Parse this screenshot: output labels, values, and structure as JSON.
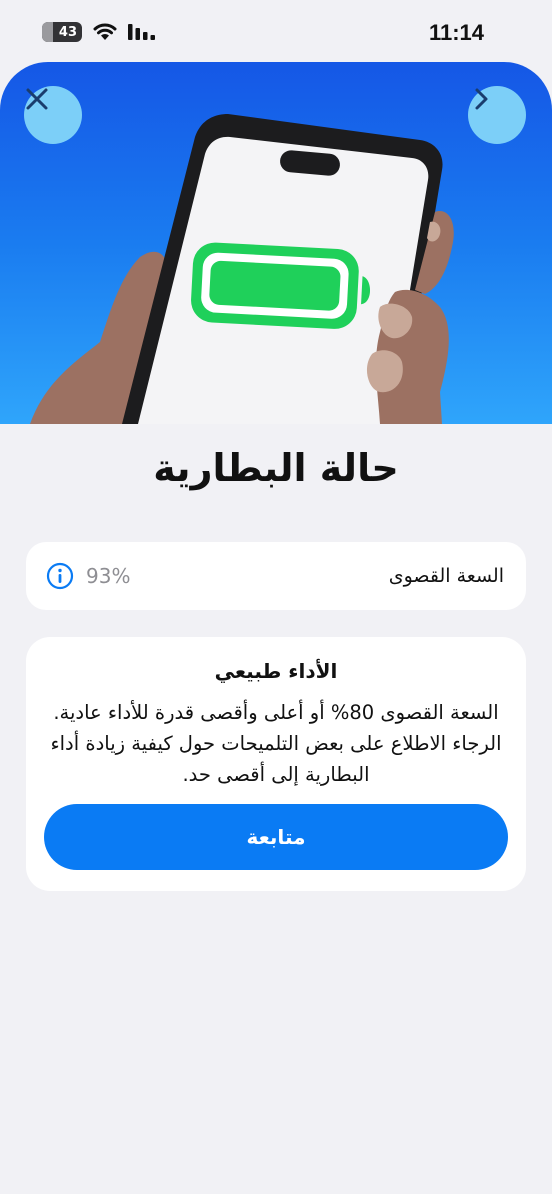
{
  "status_bar": {
    "battery_level": "43",
    "time": "11:14"
  },
  "hero": {
    "close_icon": "close-icon",
    "next_icon": "chevron-right-icon",
    "illustration": "phone-battery-illustration",
    "battery_fill_color": "#1fd05a"
  },
  "page": {
    "title": "حالة البطارية"
  },
  "capacity": {
    "label": "السعة القصوى",
    "value": "93%"
  },
  "performance": {
    "title": "الأداء طبيعي",
    "body": "السعة القصوى 80% أو أعلى وأقصى قدرة للأداء عادية. الرجاء الاطلاع على بعض التلميحات حول كيفية زيادة أداء البطارية إلى أقصى حد.",
    "button_label": "متابعة"
  },
  "colors": {
    "accent": "#0a7bf4",
    "background": "#f1f1f5",
    "card": "#ffffff"
  }
}
